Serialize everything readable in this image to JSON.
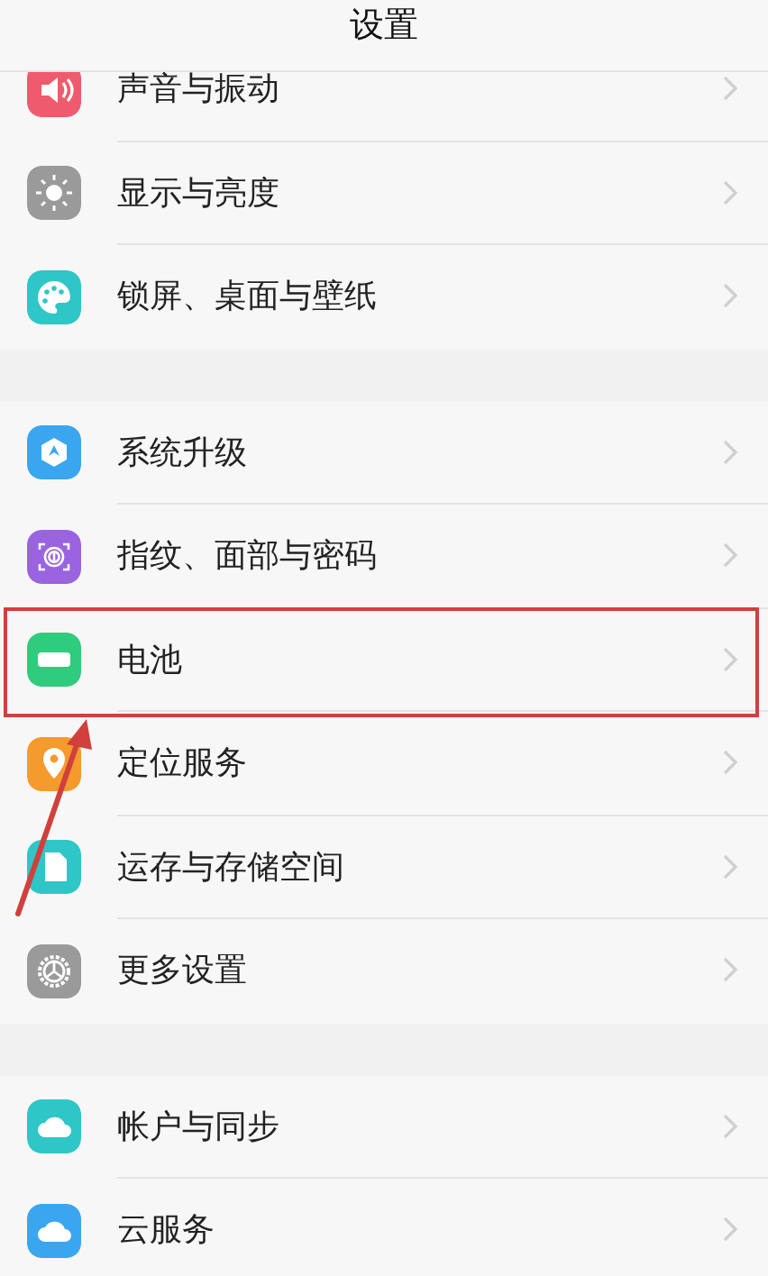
{
  "header": {
    "title": "设置"
  },
  "groups": [
    {
      "items": [
        {
          "label": "声音与振动",
          "highlighted": false
        },
        {
          "label": "显示与亮度",
          "highlighted": false
        },
        {
          "label": "锁屏、桌面与壁纸",
          "highlighted": false
        }
      ]
    },
    {
      "items": [
        {
          "label": "系统升级",
          "highlighted": false
        },
        {
          "label": "指纹、面部与密码",
          "highlighted": false
        },
        {
          "label": "电池",
          "highlighted": true
        },
        {
          "label": "定位服务",
          "highlighted": false
        },
        {
          "label": "运存与存储空间",
          "highlighted": false
        },
        {
          "label": "更多设置",
          "highlighted": false
        }
      ]
    },
    {
      "items": [
        {
          "label": "帐户与同步",
          "highlighted": false
        },
        {
          "label": "云服务",
          "highlighted": false
        }
      ]
    }
  ]
}
